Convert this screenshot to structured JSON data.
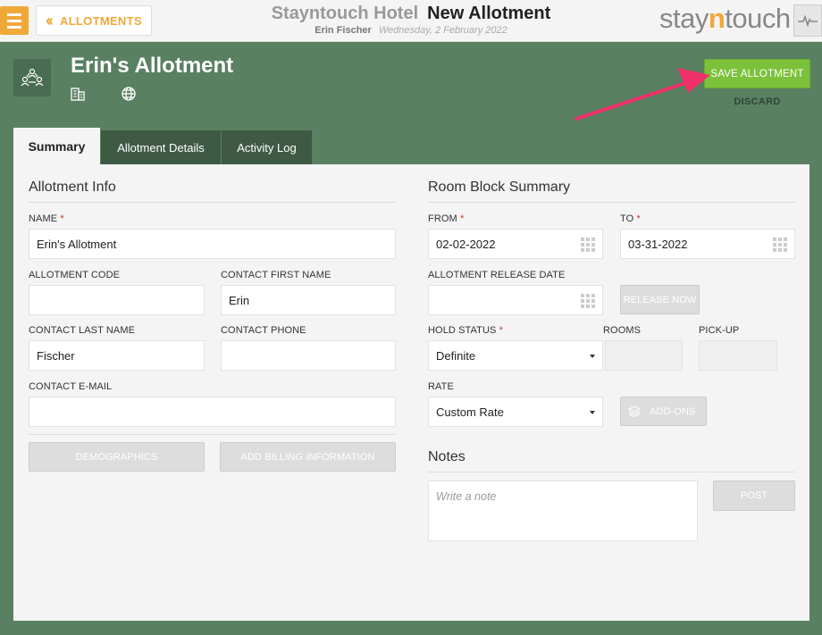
{
  "header": {
    "back_label": "ALLOTMENTS",
    "hotel_name": "Stayntouch Hotel",
    "page_title": "New Allotment",
    "user_name": "Erin Fischer",
    "date": "Wednesday, 2 February 2022",
    "logo_pre": "stay",
    "logo_n": "n",
    "logo_post": "touch"
  },
  "allotment": {
    "name": "Erin's Allotment",
    "save_label": "SAVE ALLOTMENT",
    "discard_label": "DISCARD"
  },
  "tabs": [
    {
      "label": "Summary",
      "active": true
    },
    {
      "label": "Allotment Details",
      "active": false
    },
    {
      "label": "Activity Log",
      "active": false
    }
  ],
  "allotment_info": {
    "title": "Allotment Info",
    "name_label": "NAME",
    "name_value": "Erin's Allotment",
    "code_label": "ALLOTMENT CODE",
    "code_value": "",
    "first_name_label": "CONTACT FIRST NAME",
    "first_name_value": "Erin",
    "last_name_label": "CONTACT LAST NAME",
    "last_name_value": "Fischer",
    "phone_label": "CONTACT PHONE",
    "phone_value": "",
    "email_label": "CONTACT E-MAIL",
    "email_value": "",
    "demographics_label": "DEMOGRAPHICS",
    "billing_label": "ADD BILLING INFORMATION"
  },
  "room_block": {
    "title": "Room Block Summary",
    "from_label": "FROM",
    "from_value": "02-02-2022",
    "to_label": "TO",
    "to_value": "03-31-2022",
    "release_date_label": "ALLOTMENT RELEASE DATE",
    "release_date_value": "",
    "release_now_label": "RELEASE NOW",
    "hold_status_label": "HOLD STATUS",
    "hold_status_value": "Definite",
    "rooms_label": "ROOMS",
    "pickup_label": "PICK-UP",
    "rate_label": "RATE",
    "rate_value": "Custom Rate",
    "addons_label": "ADD-ONS"
  },
  "notes": {
    "title": "Notes",
    "placeholder": "Write a note",
    "post_label": "POST"
  },
  "colors": {
    "accent": "#f0a839",
    "save_green": "#7cc13a",
    "background": "#5a8062",
    "arrow": "#f0306a"
  }
}
